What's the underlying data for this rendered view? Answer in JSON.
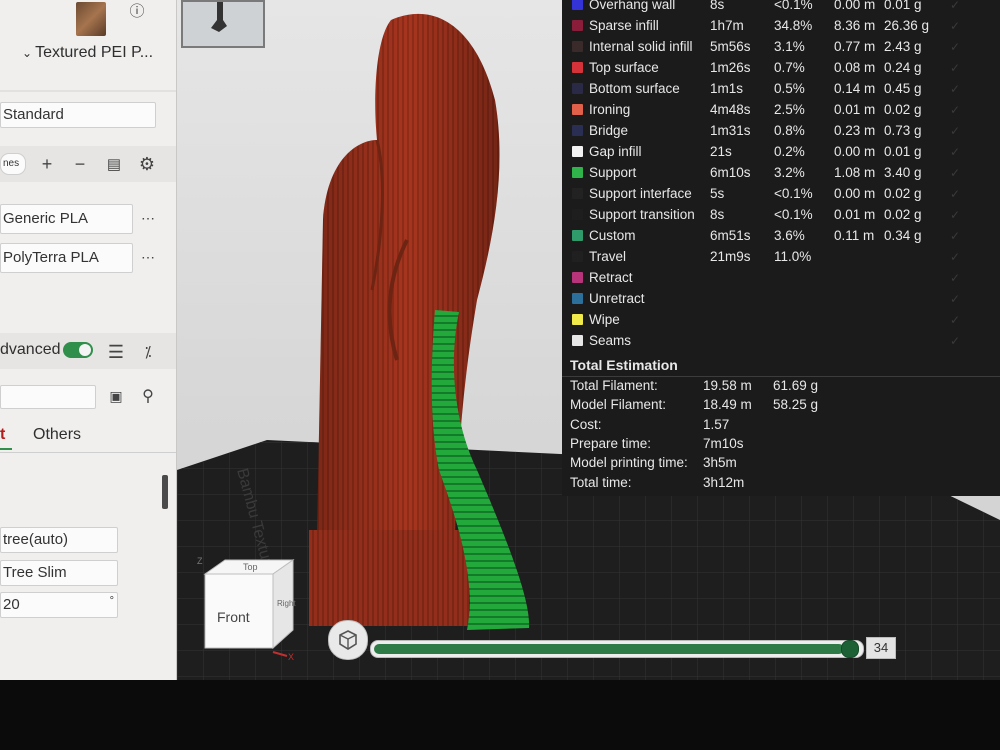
{
  "left_panel": {
    "plate_type": "Textured PEI P...",
    "profile": "Standard",
    "nozzle_chip": "nes",
    "filaments": [
      "Generic PLA",
      "PolyTerra PLA"
    ],
    "advanced_label": "dvanced",
    "tabs": {
      "active": "t",
      "other": "Others"
    },
    "support_type": "tree(auto)",
    "support_style": "Tree Slim",
    "threshold_angle": "20",
    "threshold_unit": "°"
  },
  "legend": {
    "rows": [
      {
        "name": "Overhang wall",
        "time": "8s",
        "percent": "<0.1%",
        "length": "0.00 m",
        "weight": "0.01 g",
        "color": "#3434d6"
      },
      {
        "name": "Sparse infill",
        "time": "1h7m",
        "percent": "34.8%",
        "length": "8.36 m",
        "weight": "26.36 g",
        "color": "#8a1d3a"
      },
      {
        "name": "Internal solid infill",
        "time": "5m56s",
        "percent": "3.1%",
        "length": "0.77 m",
        "weight": "2.43 g",
        "color": "#3a2a2a"
      },
      {
        "name": "Top surface",
        "time": "1m26s",
        "percent": "0.7%",
        "length": "0.08 m",
        "weight": "0.24 g",
        "color": "#d6323a"
      },
      {
        "name": "Bottom surface",
        "time": "1m1s",
        "percent": "0.5%",
        "length": "0.14 m",
        "weight": "0.45 g",
        "color": "#2a2a46"
      },
      {
        "name": "Ironing",
        "time": "4m48s",
        "percent": "2.5%",
        "length": "0.01 m",
        "weight": "0.02 g",
        "color": "#e0604a"
      },
      {
        "name": "Bridge",
        "time": "1m31s",
        "percent": "0.8%",
        "length": "0.23 m",
        "weight": "0.73 g",
        "color": "#2a2e52"
      },
      {
        "name": "Gap infill",
        "time": "21s",
        "percent": "0.2%",
        "length": "0.00 m",
        "weight": "0.01 g",
        "color": "#f2f2f2"
      },
      {
        "name": "Support",
        "time": "6m10s",
        "percent": "3.2%",
        "length": "1.08 m",
        "weight": "3.40 g",
        "color": "#2fb34a"
      },
      {
        "name": "Support interface",
        "time": "5s",
        "percent": "<0.1%",
        "length": "0.00 m",
        "weight": "0.02 g",
        "color": "#222222"
      },
      {
        "name": "Support transition",
        "time": "8s",
        "percent": "<0.1%",
        "length": "0.01 m",
        "weight": "0.02 g",
        "color": "#1e1e1e"
      },
      {
        "name": "Custom",
        "time": "6m51s",
        "percent": "3.6%",
        "length": "0.11 m",
        "weight": "0.34 g",
        "color": "#2f9a6a"
      },
      {
        "name": "Travel",
        "time": "21m9s",
        "percent": "11.0%",
        "length": "",
        "weight": "",
        "color": "#202020"
      },
      {
        "name": "Retract",
        "time": "",
        "percent": "",
        "length": "",
        "weight": "",
        "color": "#b8347a"
      },
      {
        "name": "Unretract",
        "time": "",
        "percent": "",
        "length": "",
        "weight": "",
        "color": "#2b6f9a"
      },
      {
        "name": "Wipe",
        "time": "",
        "percent": "",
        "length": "",
        "weight": "",
        "color": "#f0ea4a"
      },
      {
        "name": "Seams",
        "time": "",
        "percent": "",
        "length": "",
        "weight": "",
        "color": "#e6e6e6"
      }
    ],
    "check_mark": "✓",
    "total_title": "Total Estimation",
    "totals": [
      {
        "label": "Total Filament:",
        "value": "19.58 m",
        "value2": "61.69 g"
      },
      {
        "label": "Model Filament:",
        "value": "18.49 m",
        "value2": "58.25 g"
      },
      {
        "label": "Cost:",
        "value": "1.57",
        "value2": ""
      },
      {
        "label": "Prepare time:",
        "value": "7m10s",
        "value2": ""
      },
      {
        "label": "Model printing time:",
        "value": "3h5m",
        "value2": ""
      },
      {
        "label": "Total time:",
        "value": "3h12m",
        "value2": ""
      }
    ]
  },
  "viewport": {
    "bed_brand": "Bambu Textured",
    "nav_cube": {
      "front": "Front",
      "top": "Top",
      "right": "Right",
      "axis_x": "X",
      "axis_z": "Z"
    }
  },
  "layer_slider": {
    "value": "34",
    "fraction": 0.98
  }
}
